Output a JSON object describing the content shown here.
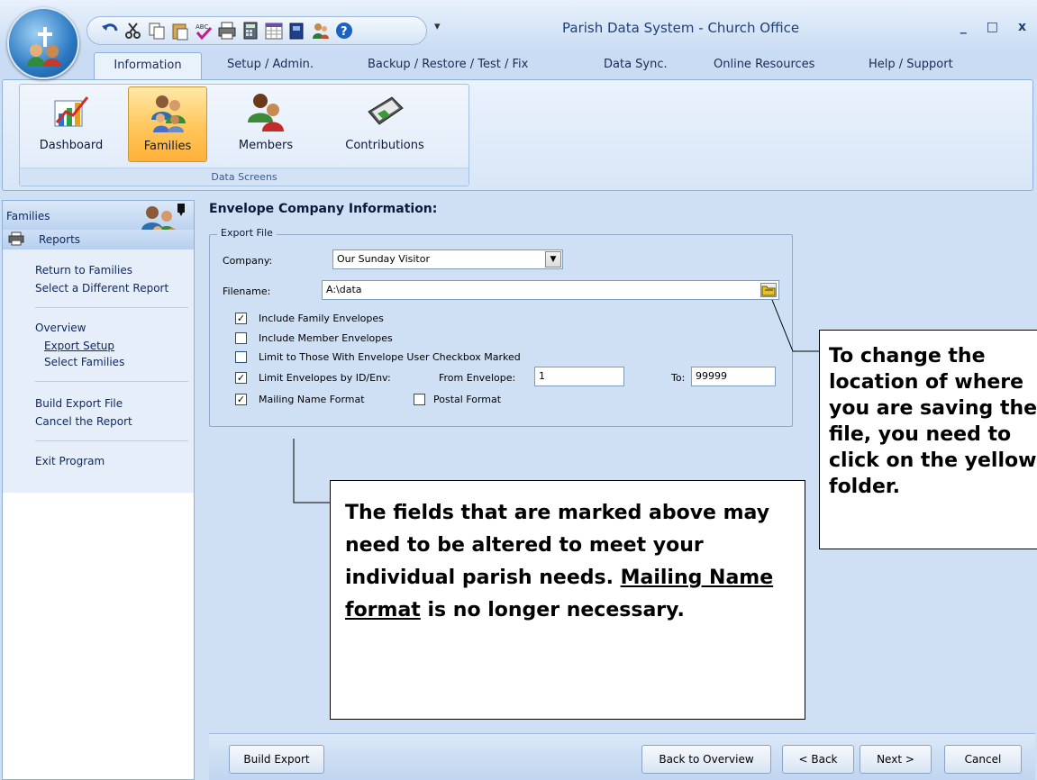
{
  "app": {
    "title": "Parish Data System - Church Office",
    "window_controls": {
      "minimize": "_",
      "maximize": "□",
      "close": "x"
    },
    "qat_more": "▾"
  },
  "quick_access_icons": [
    "undo-icon",
    "cut-icon",
    "copy-icon",
    "paste-icon",
    "spellcheck-icon",
    "print-icon",
    "calculator-icon",
    "calendar-icon",
    "book-icon",
    "people-icon",
    "help-icon"
  ],
  "tabs": [
    {
      "label": "Information",
      "active": true
    },
    {
      "label": "Setup / Admin."
    },
    {
      "label": "Backup / Restore / Test / Fix"
    },
    {
      "label": "Data Sync."
    },
    {
      "label": "Online Resources"
    },
    {
      "label": "Help / Support"
    }
  ],
  "ribbon": {
    "group_label": "Data Screens",
    "buttons": [
      {
        "label": "Dashboard",
        "icon": "chart-icon"
      },
      {
        "label": "Families",
        "icon": "family-icon",
        "selected": true
      },
      {
        "label": "Members",
        "icon": "members-icon"
      },
      {
        "label": "Contributions",
        "icon": "envelope-icon"
      }
    ]
  },
  "sidebar": {
    "title": "Families",
    "reports_label": "Reports",
    "links": {
      "return_to_families": "Return to Families",
      "select_different_report": "Select a Different Report",
      "overview": "Overview",
      "export_setup": "Export Setup",
      "select_families": "Select Families",
      "build_export_file": "Build Export File",
      "cancel_report": "Cancel the Report",
      "exit_program": "Exit Program"
    }
  },
  "main": {
    "title": "Envelope Company Information:",
    "fieldset_label": "Export File",
    "company_label": "Company:",
    "company_value": "Our Sunday Visitor",
    "filename_label": "Filename:",
    "filename_value": "A:\\data",
    "checkboxes": {
      "family_envelopes": {
        "label": "Include Family Envelopes",
        "checked": true
      },
      "member_envelopes": {
        "label": "Include Member Envelopes",
        "checked": false
      },
      "limit_user_checkbox": {
        "label": "Limit to Those With Envelope User Checkbox Marked",
        "checked": false
      },
      "limit_by_id": {
        "label": "Limit Envelopes by ID/Env:",
        "checked": true
      },
      "mailing_name": {
        "label": "Mailing Name Format",
        "checked": true
      },
      "postal_format": {
        "label": "Postal Format",
        "checked": false
      }
    },
    "from_envelope_label": "From Envelope:",
    "from_envelope_value": "1",
    "to_label": "To:",
    "to_value": "99999"
  },
  "callouts": {
    "right": "To change the location of where you are saving the file, you need to click on the yellow folder.",
    "bottom_part1": "The fields that are marked above may need to be altered to meet your individual parish needs.",
    "bottom_underlined": "Mailing Name format",
    "bottom_part2": "is no longer necessary."
  },
  "bottom_buttons": {
    "build_export": "Build Export",
    "back_to_overview": "Back to Overview",
    "back": "< Back",
    "next": "Next >",
    "cancel": "Cancel"
  }
}
